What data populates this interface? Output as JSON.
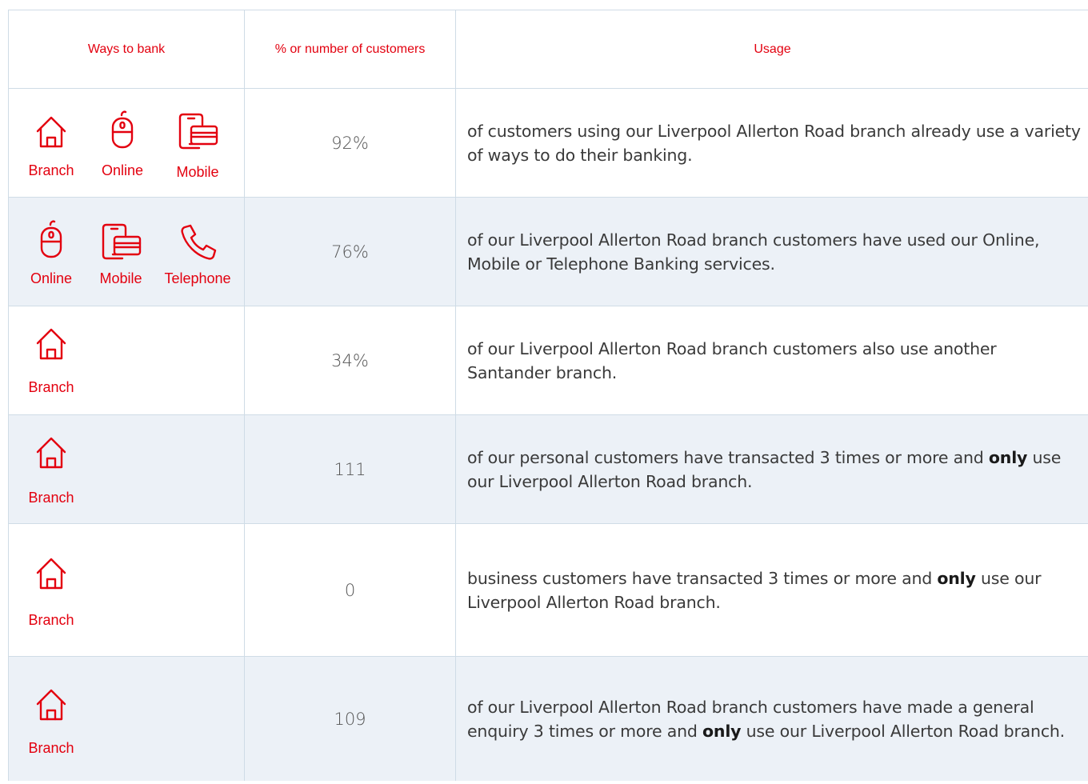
{
  "header": {
    "ways": "Ways to bank",
    "pct": "% or number of customers",
    "usage": "Usage"
  },
  "labels": {
    "branch": "Branch",
    "online": "Online",
    "mobile": "Mobile",
    "telephone": "Telephone"
  },
  "rows": [
    {
      "icons": [
        "branch",
        "online",
        "mobile"
      ],
      "value": "92%",
      "usage_parts": [
        "of customers using our Liverpool Allerton Road branch already use a variety of ways to do their banking."
      ]
    },
    {
      "icons": [
        "online",
        "mobile",
        "telephone"
      ],
      "value": "76%",
      "usage_parts": [
        "of our Liverpool Allerton Road branch customers have used our Online, Mobile or Telephone Banking services."
      ]
    },
    {
      "icons": [
        "branch"
      ],
      "value": "34%",
      "usage_parts": [
        "of our Liverpool Allerton Road branch customers also use another Santander branch."
      ]
    },
    {
      "icons": [
        "branch"
      ],
      "value": "111",
      "usage_parts": [
        "of our personal customers have transacted 3 times or more and ",
        "only",
        " use our Liverpool Allerton Road branch."
      ]
    },
    {
      "icons": [
        "branch"
      ],
      "value": "0",
      "usage_parts": [
        "business customers have transacted 3 times or more and ",
        "only",
        " use our Liverpool Allerton Road branch."
      ]
    },
    {
      "icons": [
        "branch"
      ],
      "value": "109",
      "usage_parts": [
        "of our Liverpool Allerton Road branch customers have made a general enquiry 3 times or more and ",
        "only",
        " use our Liverpool Allerton Road branch."
      ]
    }
  ],
  "colors": {
    "accent": "#e3000f",
    "alt_row": "#ecf1f7",
    "border": "#cfdce6"
  }
}
